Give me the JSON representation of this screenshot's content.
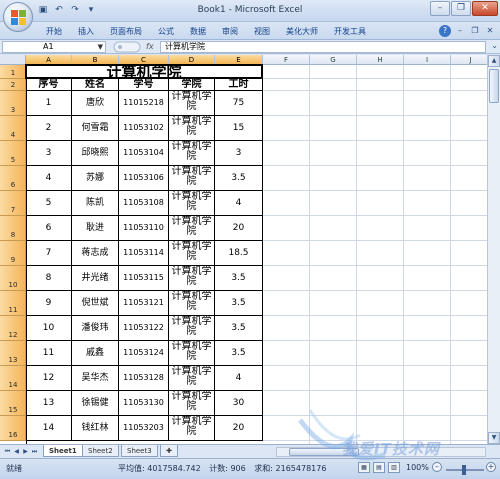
{
  "window": {
    "title": "Book1 - Microsoft Excel",
    "quick_access": [
      "save-icon",
      "undo-icon",
      "redo-icon",
      "customize-icon"
    ]
  },
  "ribbon": {
    "tabs": [
      "开始",
      "插入",
      "页面布局",
      "公式",
      "数据",
      "审阅",
      "视图",
      "美化大师",
      "开发工具"
    ]
  },
  "formula_bar": {
    "name_box": "A1",
    "fx_label": "fx",
    "content": "计算机学院"
  },
  "columns": [
    "A",
    "B",
    "C",
    "D",
    "E",
    "F",
    "G",
    "H",
    "I",
    "J"
  ],
  "rows": [
    "1",
    "2",
    "3",
    "4",
    "5",
    "6",
    "7",
    "8",
    "9",
    "10",
    "11",
    "12",
    "13",
    "14",
    "15",
    "16"
  ],
  "table": {
    "title": "计算机学院",
    "headers": [
      "序号",
      "姓名",
      "学号",
      "学院",
      "工时"
    ],
    "records": [
      [
        "1",
        "唐欣",
        "11015218",
        "计算机学院",
        "75"
      ],
      [
        "2",
        "何雪霜",
        "11053102",
        "计算机学院",
        "15"
      ],
      [
        "3",
        "邱晓熙",
        "11053104",
        "计算机学院",
        "3"
      ],
      [
        "4",
        "苏娜",
        "11053106",
        "计算机学院",
        "3.5"
      ],
      [
        "5",
        "陈凯",
        "11053108",
        "计算机学院",
        "4"
      ],
      [
        "6",
        "耿进",
        "11053110",
        "计算机学院",
        "20"
      ],
      [
        "7",
        "蒋志成",
        "11053114",
        "计算机学院",
        "18.5"
      ],
      [
        "8",
        "井光绪",
        "11053115",
        "计算机学院",
        "3.5"
      ],
      [
        "9",
        "倪世斌",
        "11053121",
        "计算机学院",
        "3.5"
      ],
      [
        "10",
        "潘俊玮",
        "11053122",
        "计算机学院",
        "3.5"
      ],
      [
        "11",
        "戚鑫",
        "11053124",
        "计算机学院",
        "3.5"
      ],
      [
        "12",
        "吴华杰",
        "11053128",
        "计算机学院",
        "4"
      ],
      [
        "13",
        "徐锡健",
        "11053130",
        "计算机学院",
        "30"
      ],
      [
        "14",
        "钱红林",
        "11053203",
        "计算机学院",
        "20"
      ]
    ]
  },
  "sheets": [
    "Sheet1",
    "Sheet2",
    "Sheet3"
  ],
  "status": {
    "ready": "就绪",
    "average": "平均值: 4017584.742",
    "count": "计数: 906",
    "sum": "求和: 2165478176",
    "zoom": "100%"
  },
  "watermark": "我爱IT技术网"
}
